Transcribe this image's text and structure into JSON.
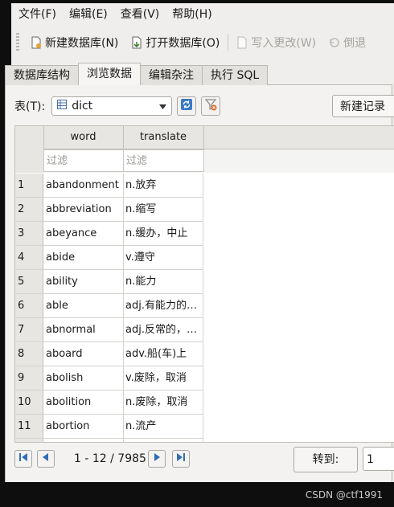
{
  "menu": [
    "文件(F)",
    "编辑(E)",
    "查看(V)",
    "帮助(H)"
  ],
  "toolbar": {
    "new_db": "新建数据库(N)",
    "open_db": "打开数据库(O)",
    "write_changes": "写入更改(W)",
    "revert": "倒退"
  },
  "tabs": [
    "数据库结构",
    "浏览数据",
    "编辑杂注",
    "执行 SQL"
  ],
  "active_tab": 1,
  "table_label": "表(T):",
  "table_selected": "dict",
  "new_record_label": "新建记录",
  "columns": [
    "word",
    "translate"
  ],
  "filter_placeholder": "过滤",
  "rows": [
    {
      "num": "1",
      "word": "abandonment",
      "translate": "n.放弃"
    },
    {
      "num": "2",
      "word": "abbreviation",
      "translate": "n.缩写"
    },
    {
      "num": "3",
      "word": "abeyance",
      "translate": "n.缓办，中止"
    },
    {
      "num": "4",
      "word": "abide",
      "translate": "v.遵守"
    },
    {
      "num": "5",
      "word": "ability",
      "translate": "n.能力"
    },
    {
      "num": "6",
      "word": "able",
      "translate": "adj.有能力的…"
    },
    {
      "num": "7",
      "word": "abnormal",
      "translate": "adj.反常的，…"
    },
    {
      "num": "8",
      "word": "aboard",
      "translate": "adv.船(车)上"
    },
    {
      "num": "9",
      "word": "abolish",
      "translate": "v.废除，取消"
    },
    {
      "num": "10",
      "word": "abolition",
      "translate": "n.废除，取消"
    },
    {
      "num": "11",
      "word": "abortion",
      "translate": "n.流产"
    }
  ],
  "navigation": {
    "range": "1 - 12 / 7985",
    "goto_label": "转到:",
    "goto_value": "1"
  },
  "watermark": "CSDN @ctf1991",
  "colors": {
    "window_bg": "#efeeec",
    "header_bg": "#e8e6e2",
    "nav_icon": "#2f6db5"
  }
}
